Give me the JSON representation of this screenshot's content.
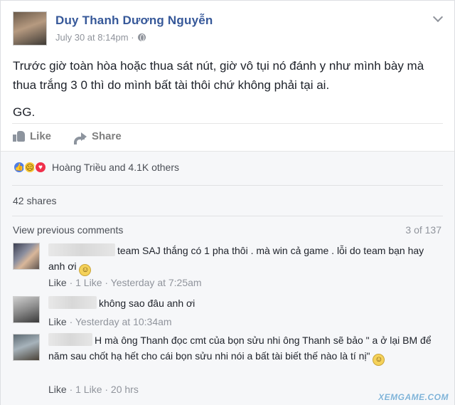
{
  "post": {
    "author": "Duy Thanh Dương Nguyễn",
    "timestamp": "July 30 at 8:14pm · ",
    "privacy_icon": "globe-icon",
    "paragraphs": [
      "Trước giờ toàn hòa hoặc thua sát nút, giờ vô tụi nó đánh y như mình bày mà thua trắng 3 0 thì do mình bất tài thôi chứ không phải tại ai.",
      "GG."
    ]
  },
  "actions": {
    "like_label": "Like",
    "share_label": "Share"
  },
  "reactions": {
    "summary": "Hoàng Triều and 4.1K others",
    "icons": [
      "like-reaction",
      "sad-reaction",
      "love-reaction"
    ]
  },
  "shares": "42 shares",
  "comments_header": {
    "view_previous": "View previous comments",
    "count": "3 of 137"
  },
  "comments": [
    {
      "text": "team SAJ thắng có 1 pha thôi . mà win cả game . lỗi do team bạn hay anh ơi",
      "like": "Like",
      "meta": " · 1 Like · Yesterday at 7:25am"
    },
    {
      "text": "không sao đâu anh ơi",
      "like": "Like",
      "meta": " · Yesterday at 10:34am"
    },
    {
      "text": "H mà ông Thanh đọc cmt của bọn sửu nhi ông Thanh sẽ bảo \" a ở lại BM để năm sau chốt hạ hết cho cái bọn sửu nhi nói a bất tài biết thế nào là tí nị\"",
      "like": "Like",
      "meta": " · 1 Like · 20 hrs"
    }
  ],
  "watermark": "XEMGAME.COM",
  "colors": {
    "name_blue": "#365899",
    "meta_gray": "#90949c",
    "feedback_bg": "#f6f7f9"
  }
}
